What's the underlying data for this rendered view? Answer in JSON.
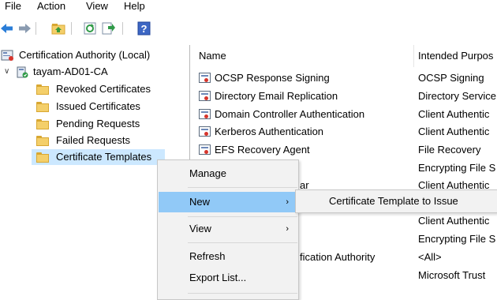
{
  "menu": {
    "file": "File",
    "action": "Action",
    "view": "View",
    "help": "Help"
  },
  "toolbar": {
    "buttons": [
      "back-icon",
      "forward-icon",
      "up-folder-icon",
      "refresh-icon",
      "export-icon",
      "help-icon"
    ]
  },
  "tree": {
    "root": "Certification Authority (Local)",
    "ca": "tayam-AD01-CA",
    "items": [
      "Revoked Certificates",
      "Issued Certificates",
      "Pending Requests",
      "Failed Requests",
      "Certificate Templates"
    ]
  },
  "list": {
    "columns": {
      "name": "Name",
      "purpose": "Intended Purpos"
    },
    "rows": [
      {
        "name": "OCSP Response Signing",
        "purpose": "OCSP Signing"
      },
      {
        "name": "Directory Email Replication",
        "purpose": "Directory Service"
      },
      {
        "name": "Domain Controller Authentication",
        "purpose": "Client Authentic"
      },
      {
        "name": "Kerberos Authentication",
        "purpose": "Client Authentic"
      },
      {
        "name": "EFS Recovery Agent",
        "purpose": "File Recovery"
      },
      {
        "name": "",
        "purpose": "Encrypting File S"
      },
      {
        "name": "ar",
        "purpose": "Client Authentic"
      },
      {
        "name": "",
        "purpose": ""
      },
      {
        "name": "",
        "purpose": "Client Authentic"
      },
      {
        "name": "",
        "purpose": "Encrypting File S"
      },
      {
        "name": "fication Authority",
        "purpose": "<All>"
      },
      {
        "name": "",
        "purpose": "Microsoft Trust"
      }
    ]
  },
  "context_menu": {
    "manage": "Manage",
    "new": "New",
    "view": "View",
    "refresh": "Refresh",
    "export": "Export List...",
    "submenu_arrow": "›"
  },
  "submenu": {
    "item": "Certificate Template to Issue"
  },
  "colors": {
    "selection": "#cce8ff",
    "menu_highlight": "#91c9f7",
    "menu_bg": "#f2f2f2"
  }
}
